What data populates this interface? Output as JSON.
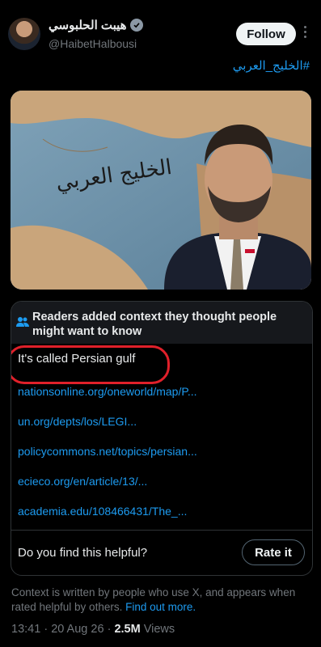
{
  "author": {
    "display_name": "هيبت الحلبوسي",
    "handle": "@HaibetHalbousi"
  },
  "follow_label": "Follow",
  "hashtag": "#الخليج_العربي",
  "image_calligraphy": "الخليج العربي",
  "note": {
    "title": "Readers added context they thought people might want to know",
    "text": "It's called Persian gulf",
    "links": [
      "nationsonline.org/oneworld/map/P...",
      "un.org/depts/los/LEGI...",
      "policycommons.net/topics/persian...",
      "ecieco.org/en/article/13/...",
      "academia.edu/108466431/The_..."
    ],
    "helpful_question": "Do you find this helpful?",
    "rate_label": "Rate it"
  },
  "context_footer": {
    "text": "Context is written by people who use X, and appears when rated helpful by others.",
    "link": "Find out more."
  },
  "meta": {
    "time": "13:41",
    "date": "20 Aug 26",
    "views_count": "2.5M",
    "views_label": "Views",
    "separator": "·"
  },
  "colors": {
    "background": "#000000",
    "link": "#1d9bf0",
    "highlight": "#e0202a"
  }
}
